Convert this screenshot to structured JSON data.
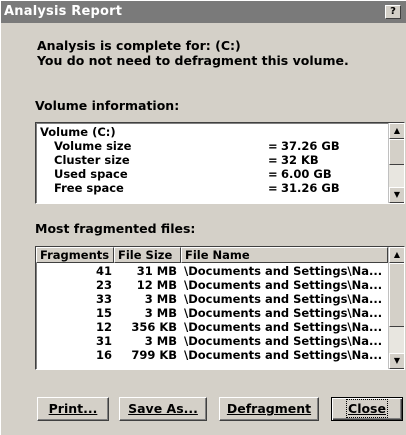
{
  "window": {
    "title": "Analysis Report",
    "help_glyph": "?"
  },
  "intro": {
    "line1": "Analysis is complete for: (C:)",
    "line2": "You do not need to defragment this volume."
  },
  "volume_info": {
    "label": "Volume information:",
    "rows": [
      {
        "label": "Volume  (C:)",
        "eq": "",
        "value": ""
      },
      {
        "label": "Volume size",
        "eq": "=",
        "value": "37.26 GB"
      },
      {
        "label": "Cluster size",
        "eq": "=",
        "value": "32 KB"
      },
      {
        "label": "Used space",
        "eq": "=",
        "value": "6.00 GB"
      },
      {
        "label": "Free space",
        "eq": "=",
        "value": "31.26 GB"
      }
    ]
  },
  "fragmented": {
    "label": "Most fragmented files:",
    "columns": [
      "Fragments",
      "File Size",
      "File Name"
    ],
    "rows": [
      {
        "fragments": "41",
        "size": "31 MB",
        "name": "\\Documents and Settings\\Na..."
      },
      {
        "fragments": "23",
        "size": "12 MB",
        "name": "\\Documents and Settings\\Na..."
      },
      {
        "fragments": "33",
        "size": "3 MB",
        "name": "\\Documents and Settings\\Na..."
      },
      {
        "fragments": "15",
        "size": "3 MB",
        "name": "\\Documents and Settings\\Na..."
      },
      {
        "fragments": "12",
        "size": "356 KB",
        "name": "\\Documents and Settings\\Na..."
      },
      {
        "fragments": "31",
        "size": "3 MB",
        "name": "\\Documents and Settings\\Na..."
      },
      {
        "fragments": "16",
        "size": "799 KB",
        "name": "\\Documents and Settings\\Na..."
      }
    ]
  },
  "buttons": {
    "print": "Print...",
    "save_as": "Save As...",
    "defragment": "Defragment",
    "close": "Close"
  },
  "icons": {
    "scroll_up": "scroll-up-arrow-icon",
    "scroll_down": "scroll-down-arrow-icon"
  }
}
